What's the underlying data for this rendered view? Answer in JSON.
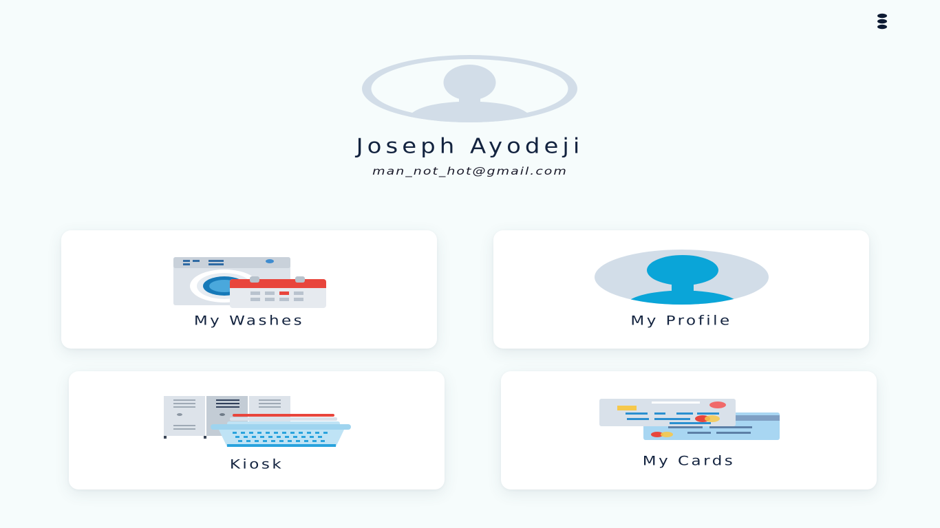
{
  "header": {
    "menu_icon": "vertical-ellipsis-icon"
  },
  "user": {
    "name": "Joseph Ayodeji",
    "email": "man_not_hot@gmail.com",
    "avatar_icon": "user-silhouette-icon"
  },
  "tiles": [
    {
      "label": "My Washes",
      "icon": "washing-machine-calendar-icon"
    },
    {
      "label": "My Profile",
      "icon": "profile-silhouette-icon"
    },
    {
      "label": "Kiosk",
      "icon": "lockers-laundry-basket-icon"
    },
    {
      "label": "My Cards",
      "icon": "credit-cards-icon"
    }
  ],
  "colors": {
    "background": "#f6fcfc",
    "text": "#13233f",
    "avatar_ring": "#d2dde8",
    "profile_accent": "#0aa5d8",
    "calendar_red": "#e8453c"
  }
}
